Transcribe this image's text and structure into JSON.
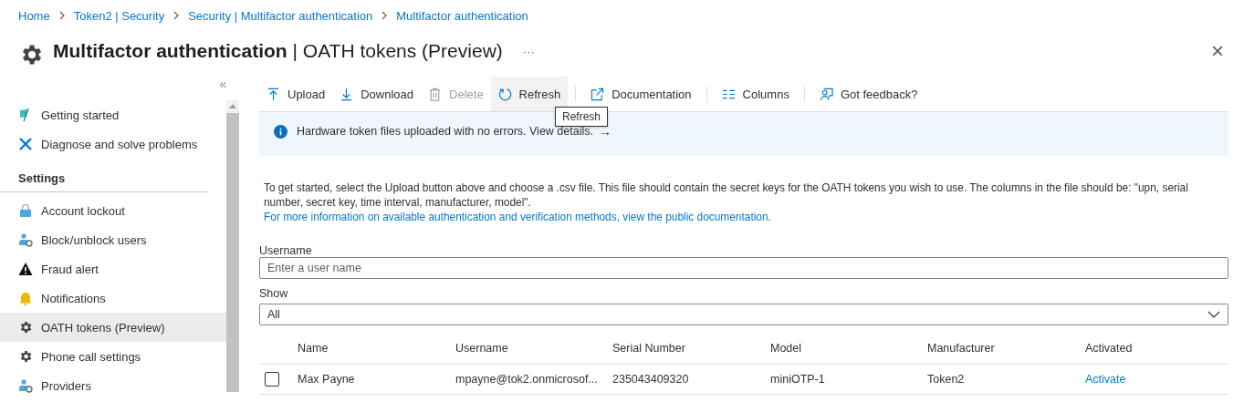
{
  "breadcrumb": [
    "Home",
    "Token2 | Security",
    "Security | Multifactor authentication",
    "Multifactor authentication"
  ],
  "page": {
    "title_bold": "Multifactor authentication",
    "separator": "|",
    "title_rest": "OATH tokens (Preview)",
    "more": "···",
    "close": "×"
  },
  "sidebar": {
    "collapse": "«",
    "items": [
      {
        "kind": "item",
        "label": "Getting started",
        "selected": false
      },
      {
        "kind": "item",
        "label": "Diagnose and solve problems",
        "selected": false
      },
      {
        "kind": "heading",
        "label": "Settings"
      },
      {
        "kind": "item",
        "label": "Account lockout",
        "selected": false
      },
      {
        "kind": "item",
        "label": "Block/unblock users",
        "selected": false
      },
      {
        "kind": "item",
        "label": "Fraud alert",
        "selected": false
      },
      {
        "kind": "item",
        "label": "Notifications",
        "selected": false
      },
      {
        "kind": "item",
        "label": "OATH tokens (Preview)",
        "selected": true
      },
      {
        "kind": "item",
        "label": "Phone call settings",
        "selected": false
      },
      {
        "kind": "item",
        "label": "Providers",
        "selected": false
      }
    ]
  },
  "toolbar": [
    {
      "label": "Upload",
      "disabled": false,
      "hovered": false,
      "divider_after": false
    },
    {
      "label": "Download",
      "disabled": false,
      "hovered": false,
      "divider_after": false
    },
    {
      "label": "Delete",
      "disabled": true,
      "hovered": false,
      "divider_after": false
    },
    {
      "label": "Refresh",
      "disabled": false,
      "hovered": true,
      "divider_after": true
    },
    {
      "label": "Documentation",
      "disabled": false,
      "hovered": false,
      "divider_after": true
    },
    {
      "label": "Columns",
      "disabled": false,
      "hovered": false,
      "divider_after": true
    },
    {
      "label": "Got feedback?",
      "disabled": false,
      "hovered": false,
      "divider_after": false
    }
  ],
  "tooltip": "Refresh",
  "banner": {
    "text": "Hardware token files uploaded with no errors. View details.",
    "arrow": "→"
  },
  "intro": "To get started, select the Upload button above and choose a .csv file. This file should contain the secret keys for the OATH tokens you wish to use. The columns in the file should be: \"upn, serial number, secret key, time interval, manufacturer, model\".",
  "doc_link": "For more information on available authentication and verification methods, view the public documentation.",
  "username": {
    "label": "Username",
    "placeholder": "Enter a user name"
  },
  "show": {
    "label": "Show",
    "value": "All"
  },
  "table": {
    "columns": [
      "Name",
      "Username",
      "Serial Number",
      "Model",
      "Manufacturer",
      "Activated"
    ],
    "rows": [
      {
        "checked": false,
        "name": "Max Payne",
        "username": "mpayne@tok2.onmicrosof...",
        "serial": "235043409320",
        "model": "miniOTP-1",
        "manufacturer": "Token2",
        "activated": "Activate"
      }
    ]
  }
}
